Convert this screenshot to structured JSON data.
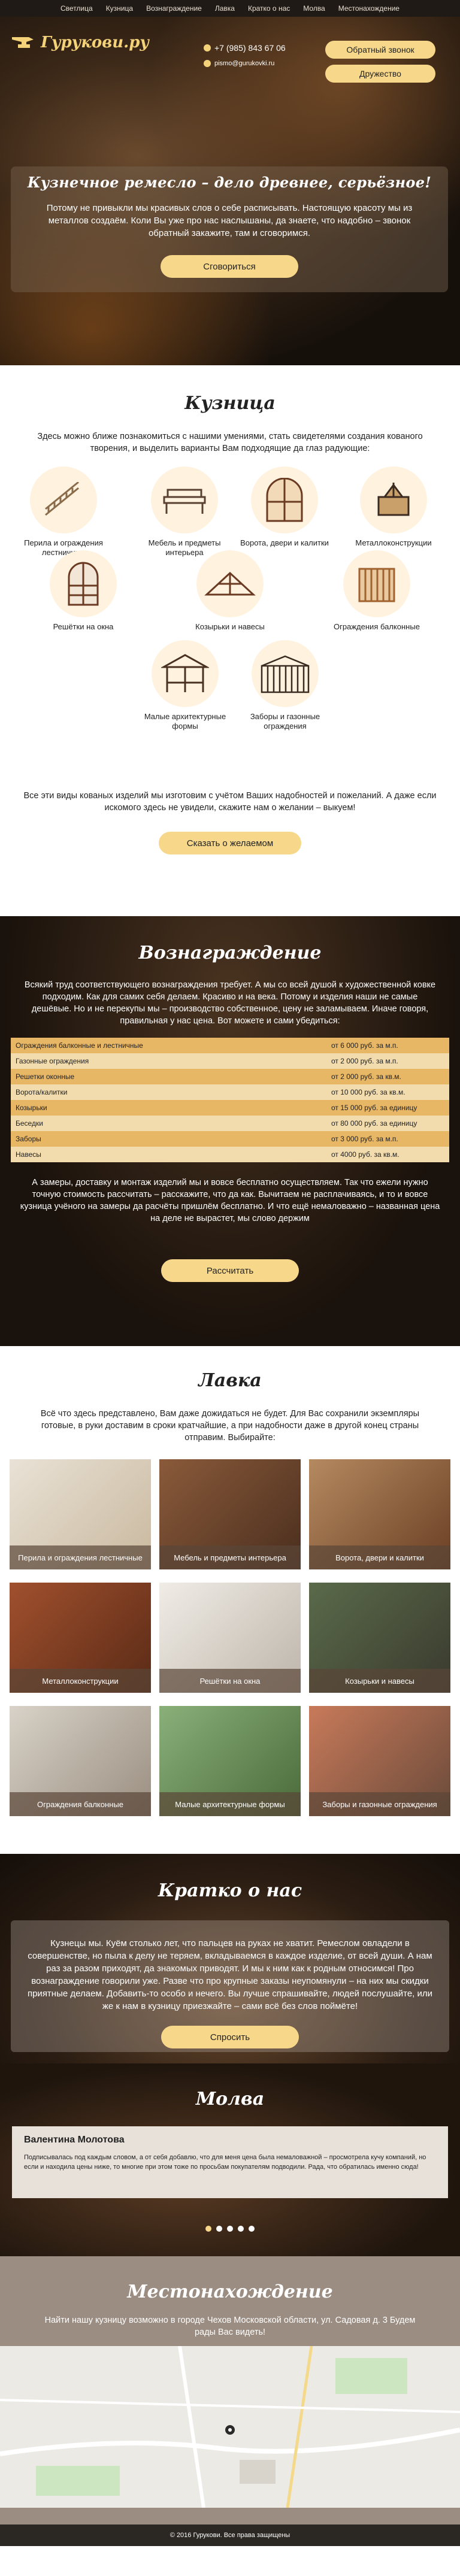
{
  "nav": [
    "Светлица",
    "Кузница",
    "Вознаграждение",
    "Лавка",
    "Кратко о нас",
    "Молва",
    "Местонахождение"
  ],
  "header": {
    "logo": "Гурукови.ру",
    "phone": "+7 (985) 843 67 06",
    "email": "pismo@gurukovki.ru",
    "callback_label": "Обратный звонок",
    "friendship_label": "Дружество"
  },
  "hero": {
    "title": "Кузнечное ремесло – дело древнее, серьёзное!",
    "text": "Потому не привыкли мы красивых слов о себе расписывать. Настоящую красоту мы из металлов создаём. Коли Вы уже про нас наслышаны, да знаете, что надобно – звонок обратный закажите, там и сговоримся.",
    "button": "Сговориться"
  },
  "kuznica": {
    "title": "Кузница",
    "intro": "Здесь можно ближе познакомиться с нашими умениями, стать свидетелями создания кованого творения, и выделить варианты Вам подходящие да глаз радующие:",
    "categories": [
      "Перила и ограждения лестничные",
      "Мебель и предметы интерьера",
      "Ворота, двери и калитки",
      "Металлоконструкции",
      "Решётки на окна",
      "Козырьки и навесы",
      "Ограждения балконные",
      "Малые архитектурные формы",
      "Заборы и газонные ограждения"
    ],
    "outro": "Все эти виды кованых изделий мы изготовим с учётом Ваших надобностей и пожеланий. А даже если искомого здесь не увидели, скажите нам о желании – выкуем!",
    "button": "Сказать о желаемом"
  },
  "voz": {
    "title": "Вознаграждение",
    "text1": "Всякий труд соответствующего вознаграждения требует. А мы со всей душой к художественной ковке подходим. Как для самих себя делаем. Красиво и на века. Потому и изделия наши не самые дешёвые. Но и не перекупы мы – производство собственное, цену не заламываем. Иначе говоря, правильная у нас цена. Вот можете и сами убедиться:",
    "prices": [
      {
        "name": "Ограждения балконные и лестничные",
        "price": "от 6 000 руб. за м.п."
      },
      {
        "name": "Газонные ограждения",
        "price": "от 2 000 руб. за м.п."
      },
      {
        "name": "Решетки оконные",
        "price": "от 2 000 руб. за кв.м."
      },
      {
        "name": "Ворота/калитки",
        "price": "от 10 000 руб. за кв.м."
      },
      {
        "name": "Козырьки",
        "price": "от 15 000 руб. за единицу"
      },
      {
        "name": "Беседки",
        "price": "от 80 000 руб. за единицу"
      },
      {
        "name": "Заборы",
        "price": "от 3 000 руб. за м.п."
      },
      {
        "name": "Навесы",
        "price": "от 4000 руб. за кв.м."
      }
    ],
    "text2": "А замеры, доставку и монтаж изделий мы и вовсе бесплатно осуществляем. Так что ежели нужно точную стоимость рассчитать – расскажите, что да как. Вычитаем не расплачиваясь, и то и вовсе кузница учёного на замеры да расчёты пришлём бесплатно. И что ещё немаловажно – названная цена на деле не вырастет, мы слово держим",
    "button": "Рассчитать"
  },
  "lavka": {
    "title": "Лавка",
    "intro": "Всё что здесь представлено, Вам даже дожидаться не будет. Для Вас сохранили экземпляры готовые, в руки доставим в сроки кратчайшие, а при надобности даже в другой конец страны отправим. Выбирайте:",
    "items": [
      "Перила и ограждения лестничные",
      "Мебель и предметы интерьера",
      "Ворота, двери и калитки",
      "Металлоконструкции",
      "Решётки на окна",
      "Козырьки и навесы",
      "Ограждения балконные",
      "Малые архитектурные формы",
      "Заборы и газонные ограждения"
    ]
  },
  "about": {
    "title": "Кратко о нас",
    "text": "Кузнецы мы. Куём столько лет, что пальцев на руках не хватит. Ремеслом овладели в совершенстве, но пыла к делу не теряем, вкладываемся в каждое изделие, от всей души. А нам раз за разом приходят, да знакомых приводят. И мы к ним как к родным относимся! Про вознаграждение говорили уже. Разве что про крупные заказы неупомянули – на них мы скидки приятные делаем. Добавить-то особо и нечего. Вы лучше спрашивайте, людей послушайте, или же к нам в кузницу приезжайте – сами всё без слов поймёте!",
    "button": "Спросить"
  },
  "molva": {
    "title": "Молва",
    "review_name": "Валентина Молотова",
    "review_text": "Подписывалась под каждым словом, а от себя добавлю, что для меня цена была немаловажной – просмотрела кучу компаний, но если и находила цены ниже, то многие при этом тоже по просьбам покупателям подводили. Рада, что обратилась именно сюда!"
  },
  "place": {
    "title": "Местонахождение",
    "text": "Найти нашу кузницу возможно в городе Чехов Московской области, ул. Садовая д. 3 Будем рады Вас видеть!"
  },
  "footer": "© 2016 Гурукови. Все права защищены",
  "colors": {
    "accent": "#f7d88a",
    "dark": "#1f1a16",
    "price_odd": "#e8b766",
    "price_even": "#f2dcae"
  }
}
